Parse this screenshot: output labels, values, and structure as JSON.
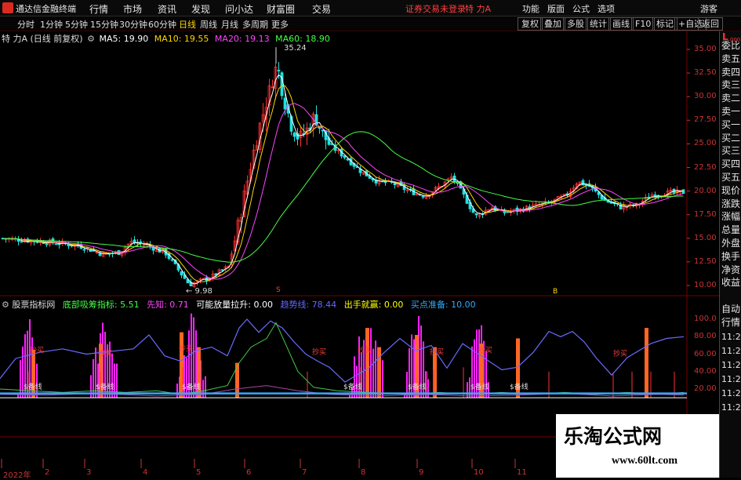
{
  "app": {
    "title": "通达信金融终端",
    "menu": [
      "行情",
      "市场",
      "资讯",
      "发现",
      "问小达",
      "财富圈",
      "交易"
    ],
    "status": "证券交易未登录",
    "stock_name": "特 力A",
    "right_menu": [
      "功能",
      "版面",
      "公式",
      "选项"
    ],
    "guest": "游客"
  },
  "toolbar": {
    "periods": [
      "分时",
      "1分钟",
      "5分钟",
      "15分钟",
      "30分钟",
      "60分钟",
      "日线",
      "周线",
      "月线",
      "多周期",
      "更多"
    ],
    "active_period": "日线",
    "buttons": [
      "复权",
      "叠加",
      "多股",
      "统计",
      "画线",
      "F10",
      "标记",
      "+自选",
      "返回"
    ]
  },
  "main_chart": {
    "title": "特 力A (日线 前复权)",
    "ma": [
      {
        "label": "MA5: 19.90",
        "color": "#ffffff"
      },
      {
        "label": "MA10: 19.55",
        "color": "#ffd700"
      },
      {
        "label": "MA20: 19.13",
        "color": "#ff44ff"
      },
      {
        "label": "MA60: 18.90",
        "color": "#44ff44"
      }
    ],
    "high_label": "35.24",
    "low_label": "9.98",
    "y_ticks": [
      "35.00",
      "32.50",
      "30.00",
      "27.50",
      "25.00",
      "22.50",
      "20.00",
      "17.50",
      "15.00",
      "12.50",
      "10.00"
    ],
    "marker_a": "S",
    "marker_b": "B"
  },
  "indicator": {
    "name": "股票指标网",
    "fields": [
      {
        "label": "底部吸筹指标: 5.51",
        "color": "#44ff44"
      },
      {
        "label": "先知: 0.71",
        "color": "#ff44ff"
      },
      {
        "label": "可能放量拉升: 0.00",
        "color": "#ffffff"
      },
      {
        "label": "趋势线: 78.44",
        "color": "#6666ff"
      },
      {
        "label": "出手就赢: 0.00",
        "color": "#ffff00"
      },
      {
        "label": "买点准备: 10.00",
        "color": "#33aaff"
      }
    ],
    "y_ticks": [
      "100.0",
      "80.00",
      "60.00",
      "40.00",
      "20.00"
    ],
    "tag_prepare": "$备线",
    "tag_buy": "抄买"
  },
  "sidebar": {
    "top": "L",
    "top_sub": "000",
    "items": [
      "委比",
      "卖五",
      "卖四",
      "卖三",
      "卖二",
      "卖一",
      "买一",
      "买二",
      "买三",
      "买四",
      "买五",
      "现价",
      "涨跌",
      "涨幅",
      "总量",
      "外盘",
      "换手",
      "净资",
      "收益",
      "自动",
      "行情"
    ],
    "times": [
      "11:2",
      "11:2",
      "11:2",
      "11:2",
      "11:2",
      "11:2"
    ]
  },
  "x_axis": [
    "2022年",
    "2",
    "3",
    "4",
    "5",
    "6",
    "7",
    "8",
    "9",
    "10",
    "11"
  ],
  "watermark": {
    "main": "乐淘公式网",
    "url": "www.60lt.com"
  },
  "colors": {
    "up": "#ff3030",
    "down": "#20e0e0",
    "axis": "#cc3333"
  }
}
